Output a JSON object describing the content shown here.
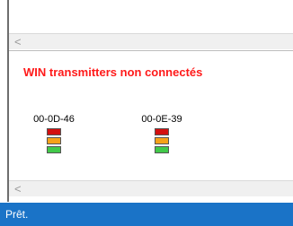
{
  "scrollbar": {
    "left_arrow": "<"
  },
  "panel": {
    "title": "WIN transmitters non connectés",
    "transmitters": [
      {
        "id": "00-0D-46",
        "leds": [
          "red",
          "orange",
          "green"
        ]
      },
      {
        "id": "00-0E-39",
        "leds": [
          "red",
          "orange",
          "green"
        ]
      }
    ]
  },
  "status": {
    "text": "Prêt."
  },
  "colors": {
    "title": "#ff1a1a",
    "led_red": "#d31010",
    "led_orange": "#f6a21a",
    "led_green": "#42c94a",
    "statusbar": "#1a73c7"
  }
}
